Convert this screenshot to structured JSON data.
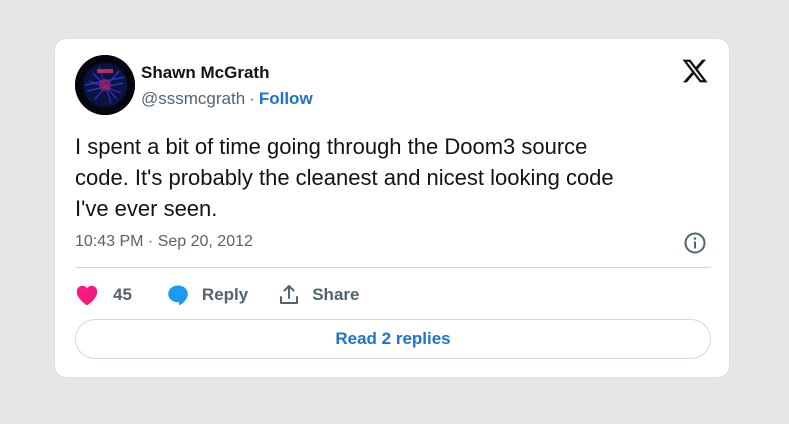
{
  "author": {
    "name": "Shawn McGrath",
    "handle": "@sssmcgrath",
    "separator": "·",
    "follow_label": "Follow"
  },
  "tweet": {
    "text": "I spent a bit of time going through the Doom3 source\ncode.  It's probably the cleanest and nicest looking code\nI've ever seen.",
    "timestamp": "10:43 PM · Sep 20, 2012"
  },
  "actions": {
    "like_count": "45",
    "reply_label": "Reply",
    "share_label": "Share"
  },
  "read_replies_label": "Read 2 replies",
  "icons": {
    "avatar": "avatar-image",
    "platform_logo": "x-logo-icon",
    "info": "info-icon",
    "like": "heart-icon",
    "reply": "speech-bubble-icon",
    "share": "share-upload-icon"
  },
  "colors": {
    "link": "#1d74c9",
    "like": "#f91880",
    "reply": "#1d9bf0",
    "muted": "#536471",
    "text": "#0f1419",
    "background": "#e6e6e6",
    "card": "#ffffff"
  }
}
